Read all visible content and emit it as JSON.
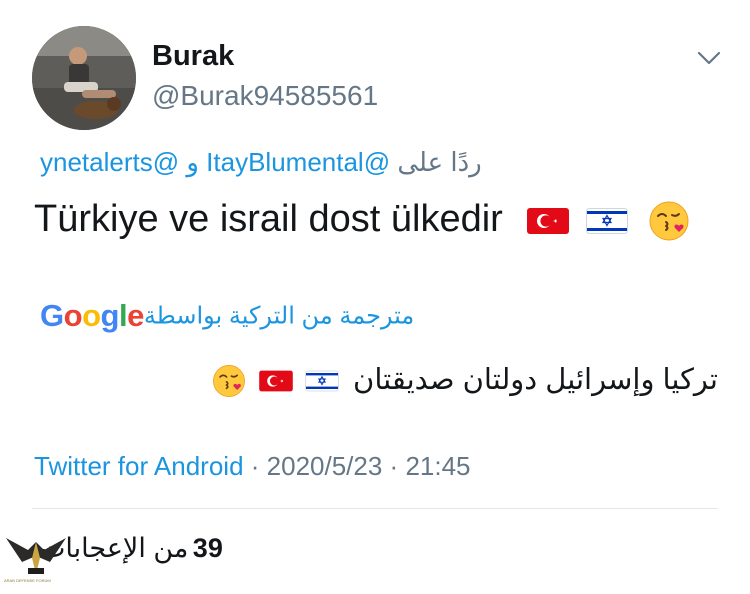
{
  "user": {
    "display_name": "Burak",
    "handle": "@Burak94585561"
  },
  "reply": {
    "prefix": "ردًا على",
    "mention_1": "@ItayBlumental",
    "conjunction": "و",
    "mention_2": "@ynetalerts"
  },
  "tweet": {
    "text": "Türkiye ve israil dost ülkedir",
    "emojis": [
      "turkey-flag",
      "israel-flag",
      "kissing-face-with-heart"
    ]
  },
  "translation": {
    "label": "مترجمة من التركية بواسطة",
    "provider": "Google",
    "provider_letters": [
      "G",
      "o",
      "o",
      "g",
      "l",
      "e"
    ],
    "provider_colors": [
      "#4285F4",
      "#EA4335",
      "#FBBC05",
      "#4285F4",
      "#34A853",
      "#EA4335"
    ],
    "text": "تركيا وإسرائيل دولتان صديقتان"
  },
  "meta": {
    "source": "Twitter for Android",
    "separator": " · ",
    "date": "2020/5/23",
    "time": "21:45"
  },
  "stats": {
    "likes_count": "39",
    "likes_label": "من الإعجابات"
  },
  "watermark": {
    "text": "ARAB DEFENSE FORUM"
  },
  "colors": {
    "link": "#1b95e0",
    "secondary": "#657786",
    "primary_text": "#14171a",
    "divider": "#e1e8ed"
  }
}
